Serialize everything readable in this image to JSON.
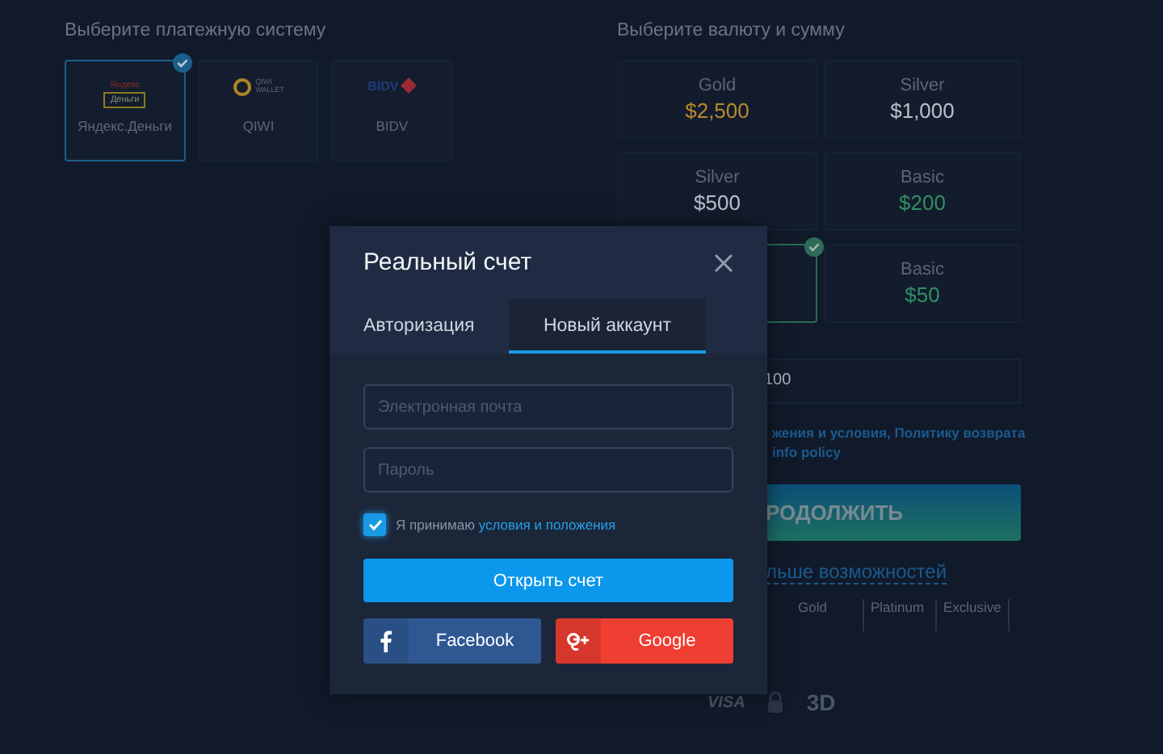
{
  "payment": {
    "heading": "Выберите платежную систему",
    "systems": [
      {
        "kind": "yandex",
        "logo_top": "Яндекс",
        "logo_tag": "Деньги",
        "label": "Яндекс.Деньги",
        "selected": true
      },
      {
        "kind": "qiwi",
        "logo_top": "QIWI",
        "logo_tag": "WALLET",
        "label": "QIWI",
        "selected": false
      },
      {
        "kind": "bidv",
        "logo_top": "BIDV",
        "label": "BIDV",
        "selected": false
      }
    ]
  },
  "amount": {
    "heading": "Выберите валюту и сумму",
    "plans": [
      {
        "tier": "Gold",
        "amount": "$2,500",
        "color": "#b98a2e",
        "selected": false
      },
      {
        "tier": "Silver",
        "amount": "$1,000",
        "color": "#b9c0c9",
        "selected": false
      },
      {
        "tier": "Silver",
        "amount": "$500",
        "color": "#b9c0c9",
        "selected": false
      },
      {
        "tier": "Basic",
        "amount": "$200",
        "color": "#2f8f64",
        "selected": false
      },
      {
        "selected": true
      },
      {
        "tier": "Basic",
        "amount": "$50",
        "color": "#2f8f64",
        "selected": false
      }
    ],
    "field_value": "100",
    "terms_line_1": "жения и условия, Политику возврата",
    "terms_line_2": "info policy",
    "continue": "РОДОЛЖИТЬ",
    "more_link": "льше возможностей",
    "levels": [
      "Gold",
      "Platinum",
      "Exclusive"
    ],
    "visa": "VISA",
    "secure_3d": "3D"
  },
  "modal": {
    "title": "Реальный счет",
    "tabs": [
      {
        "label": "Авторизация",
        "selected": false
      },
      {
        "label": "Новый аккаунт",
        "selected": true
      }
    ],
    "email": {
      "placeholder": "Электронная почта"
    },
    "password": {
      "placeholder": "Пароль"
    },
    "agree": {
      "checked": true,
      "text": "Я принимаю ",
      "link": "условия и положения"
    },
    "submit": "Открыть счет",
    "social": [
      {
        "kind": "facebook",
        "label": "Facebook"
      },
      {
        "kind": "google",
        "label": "Google"
      }
    ]
  }
}
